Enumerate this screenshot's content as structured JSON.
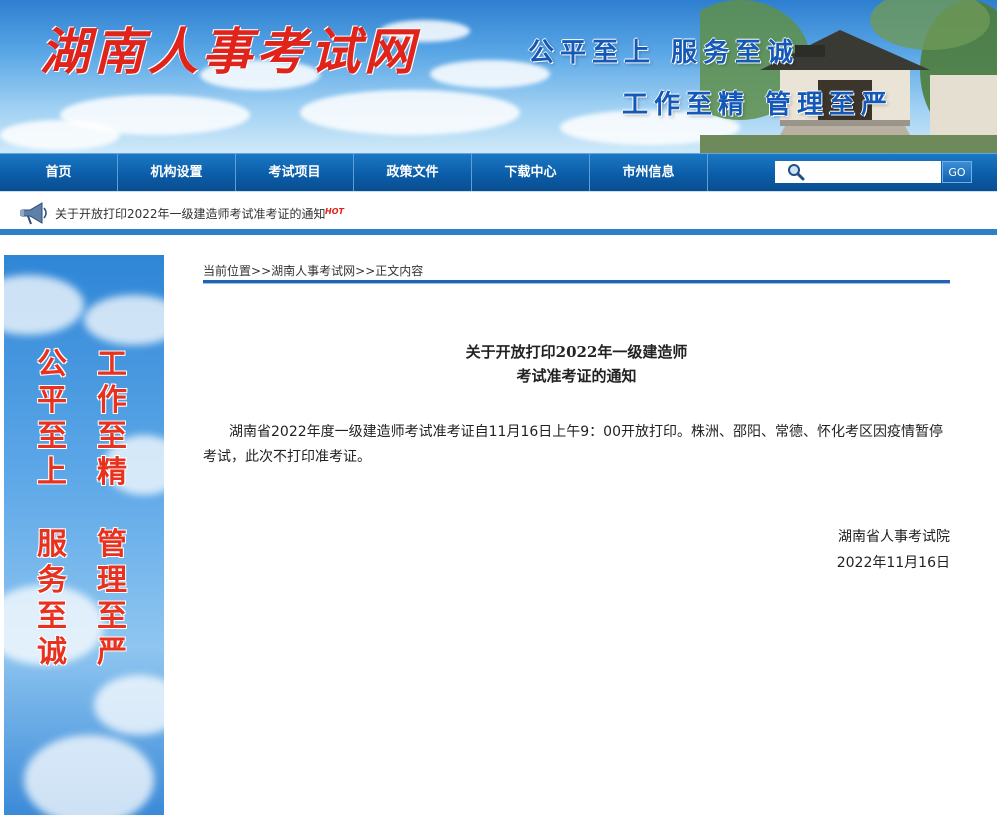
{
  "header": {
    "site_title": "湖南人事考试网",
    "slogan_line1": "公平至上  服务至诚",
    "slogan_line2": "工作至精  管理至严"
  },
  "nav": {
    "items": [
      "首页",
      "机构设置",
      "考试项目",
      "政策文件",
      "下载中心",
      "市州信息"
    ],
    "search_placeholder": "",
    "go_label": "GO"
  },
  "notice": {
    "text": "关于开放打印2022年一级建造师考试准考证的通知",
    "badge": "HOT"
  },
  "side_banner": {
    "col1": "公平至上",
    "col2": "工作至精",
    "col3": "服务至诚",
    "col4": "管理至严"
  },
  "breadcrumb": {
    "label": "当前位置",
    "sep1": ">>",
    "site": "湖南人事考试网",
    "sep2": ">>",
    "current": "正文内容"
  },
  "article": {
    "title_line1": "关于开放打印2022年一级建造师",
    "title_line2": "考试准考证的通知",
    "body": "湖南省2022年度一级建造师考试准考证自11月16日上午9：00开放打印。株洲、邵阳、常德、怀化考区因疫情暂停考试，此次不打印准考证。",
    "signer": "湖南省人事考试院",
    "date": "2022年11月16日"
  },
  "colors": {
    "nav_blue": "#0b5ba6",
    "title_red": "#e0241b",
    "slogan_blue": "#1459b8",
    "rule_blue": "#1f63b3"
  }
}
